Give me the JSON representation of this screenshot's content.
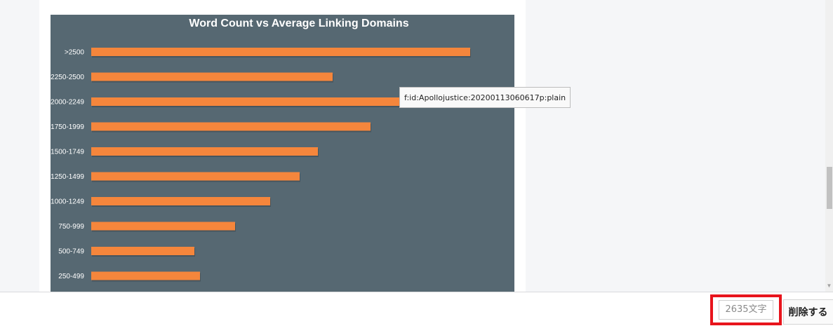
{
  "chart_data": {
    "type": "bar",
    "orientation": "horizontal",
    "title": "Word Count vs Average Linking Domains",
    "categories": [
      ">2500",
      "2250-2500",
      "2000-2249",
      "1750-1999",
      "1500-1749",
      "1250-1499",
      "1000-1249",
      "750-999",
      "500-749",
      "250-499"
    ],
    "values": [
      540,
      344,
      440,
      398,
      323,
      297,
      255,
      205,
      147,
      155
    ],
    "xlim": [
      0,
      540
    ],
    "grid": false,
    "colors": {
      "bar": "#f5863c",
      "background": "#566872",
      "title": "#ffffff",
      "labels": "#ffffff"
    }
  },
  "tooltip": {
    "text": "f:id:Apollojustice:20200113060617p:plain"
  },
  "footer": {
    "word_count": "2635文字",
    "delete_label": "削除する"
  }
}
